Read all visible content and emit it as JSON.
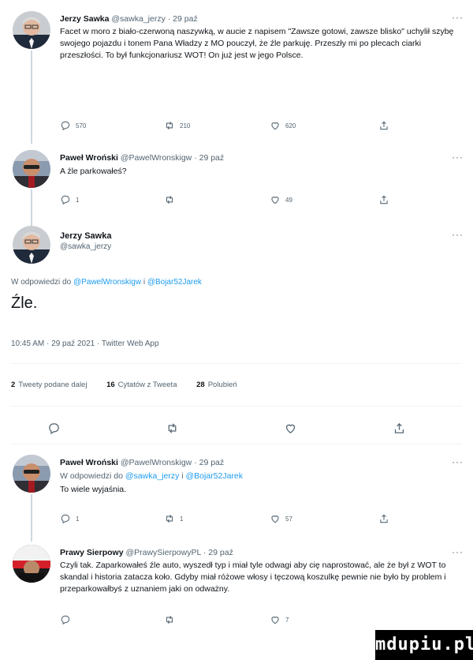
{
  "tweets_above": [
    {
      "name": "Jerzy Sawka",
      "handle": "@sawka_jerzy",
      "time": "· 29 paź",
      "text": "Facet w moro z biało-czerwoną naszywką, w aucie z napisem \"Zawsze gotowi, zawsze blisko\" uchylił szybę swojego pojazdu i tonem Pana Władzy z MO pouczył, że źle parkuję. Przeszły mi po plecach ciarki przeszłości. To był funkcjonariusz WOT! On już jest w jego Polsce.",
      "replies": "570",
      "retweets": "210",
      "likes": "620"
    },
    {
      "name": "Paweł Wroński",
      "handle": "@PawelWronskigw",
      "time": "· 29 paź",
      "text": "A źle parkowałeś?",
      "replies": "1",
      "retweets": "",
      "likes": "49"
    }
  ],
  "main": {
    "name": "Jerzy Sawka",
    "handle": "@sawka_jerzy",
    "reply_prefix": "W odpowiedzi do ",
    "reply_user1": "@PawelWronskigw",
    "reply_sep": " i ",
    "reply_user2": "@Bojar52Jarek",
    "text": "Źle.",
    "timestamp": "10:45 AM · 29 paź 2021 · Twitter Web App",
    "stats": [
      {
        "count": "2",
        "label": "Tweety podane dalej"
      },
      {
        "count": "16",
        "label": "Cytatów z Tweeta"
      },
      {
        "count": "28",
        "label": "Polubień"
      }
    ]
  },
  "replies": [
    {
      "name": "Paweł Wroński",
      "handle": "@PawelWronskigw",
      "time": "· 29 paź",
      "reply_prefix": "W odpowiedzi do ",
      "reply_user1": "@sawka_jerzy",
      "reply_sep": " i ",
      "reply_user2": "@Bojar52Jarek",
      "text": "To wiele wyjaśnia.",
      "replies": "1",
      "retweets": "1",
      "likes": "57"
    },
    {
      "name": "Prawy Sierpowy",
      "handle": "@PrawySierpowyPL",
      "time": "· 29 paź",
      "text": "Czyli tak. Zaparkowałeś źle auto, wyszedł typ i miał tyle odwagi aby cię naprostować, ale że był z WOT to skandal i historia zatacza koło. Gdyby miał różowe włosy i tęczową koszulkę pewnie nie było by problem i przeparkowałbyś z uznaniem jaki on odważny.",
      "replies": "",
      "retweets": "",
      "likes": "7"
    }
  ],
  "more_label": "···",
  "watermark": "mdupiu.pl",
  "icons": [
    "reply-icon",
    "retweet-icon",
    "like-icon",
    "share-icon"
  ],
  "colors": {
    "link": "#1d9bf0",
    "muted": "#536471",
    "line": "#cfd9de"
  }
}
